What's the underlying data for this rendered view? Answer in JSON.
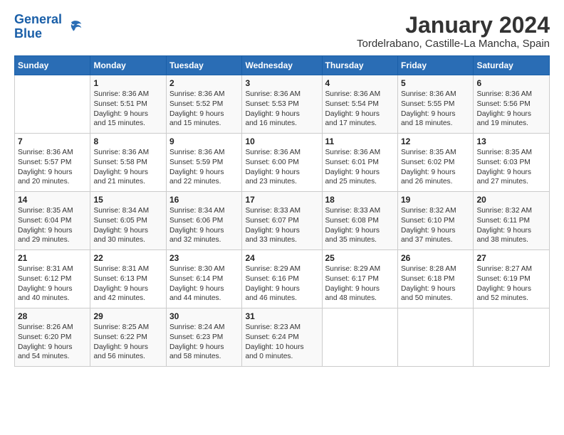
{
  "logo": {
    "text1": "General",
    "text2": "Blue"
  },
  "title": "January 2024",
  "subtitle": "Tordelrabano, Castille-La Mancha, Spain",
  "headers": [
    "Sunday",
    "Monday",
    "Tuesday",
    "Wednesday",
    "Thursday",
    "Friday",
    "Saturday"
  ],
  "weeks": [
    [
      {
        "num": "",
        "info": ""
      },
      {
        "num": "1",
        "info": "Sunrise: 8:36 AM\nSunset: 5:51 PM\nDaylight: 9 hours\nand 15 minutes."
      },
      {
        "num": "2",
        "info": "Sunrise: 8:36 AM\nSunset: 5:52 PM\nDaylight: 9 hours\nand 15 minutes."
      },
      {
        "num": "3",
        "info": "Sunrise: 8:36 AM\nSunset: 5:53 PM\nDaylight: 9 hours\nand 16 minutes."
      },
      {
        "num": "4",
        "info": "Sunrise: 8:36 AM\nSunset: 5:54 PM\nDaylight: 9 hours\nand 17 minutes."
      },
      {
        "num": "5",
        "info": "Sunrise: 8:36 AM\nSunset: 5:55 PM\nDaylight: 9 hours\nand 18 minutes."
      },
      {
        "num": "6",
        "info": "Sunrise: 8:36 AM\nSunset: 5:56 PM\nDaylight: 9 hours\nand 19 minutes."
      }
    ],
    [
      {
        "num": "7",
        "info": "Sunrise: 8:36 AM\nSunset: 5:57 PM\nDaylight: 9 hours\nand 20 minutes."
      },
      {
        "num": "8",
        "info": "Sunrise: 8:36 AM\nSunset: 5:58 PM\nDaylight: 9 hours\nand 21 minutes."
      },
      {
        "num": "9",
        "info": "Sunrise: 8:36 AM\nSunset: 5:59 PM\nDaylight: 9 hours\nand 22 minutes."
      },
      {
        "num": "10",
        "info": "Sunrise: 8:36 AM\nSunset: 6:00 PM\nDaylight: 9 hours\nand 23 minutes."
      },
      {
        "num": "11",
        "info": "Sunrise: 8:36 AM\nSunset: 6:01 PM\nDaylight: 9 hours\nand 25 minutes."
      },
      {
        "num": "12",
        "info": "Sunrise: 8:35 AM\nSunset: 6:02 PM\nDaylight: 9 hours\nand 26 minutes."
      },
      {
        "num": "13",
        "info": "Sunrise: 8:35 AM\nSunset: 6:03 PM\nDaylight: 9 hours\nand 27 minutes."
      }
    ],
    [
      {
        "num": "14",
        "info": "Sunrise: 8:35 AM\nSunset: 6:04 PM\nDaylight: 9 hours\nand 29 minutes."
      },
      {
        "num": "15",
        "info": "Sunrise: 8:34 AM\nSunset: 6:05 PM\nDaylight: 9 hours\nand 30 minutes."
      },
      {
        "num": "16",
        "info": "Sunrise: 8:34 AM\nSunset: 6:06 PM\nDaylight: 9 hours\nand 32 minutes."
      },
      {
        "num": "17",
        "info": "Sunrise: 8:33 AM\nSunset: 6:07 PM\nDaylight: 9 hours\nand 33 minutes."
      },
      {
        "num": "18",
        "info": "Sunrise: 8:33 AM\nSunset: 6:08 PM\nDaylight: 9 hours\nand 35 minutes."
      },
      {
        "num": "19",
        "info": "Sunrise: 8:32 AM\nSunset: 6:10 PM\nDaylight: 9 hours\nand 37 minutes."
      },
      {
        "num": "20",
        "info": "Sunrise: 8:32 AM\nSunset: 6:11 PM\nDaylight: 9 hours\nand 38 minutes."
      }
    ],
    [
      {
        "num": "21",
        "info": "Sunrise: 8:31 AM\nSunset: 6:12 PM\nDaylight: 9 hours\nand 40 minutes."
      },
      {
        "num": "22",
        "info": "Sunrise: 8:31 AM\nSunset: 6:13 PM\nDaylight: 9 hours\nand 42 minutes."
      },
      {
        "num": "23",
        "info": "Sunrise: 8:30 AM\nSunset: 6:14 PM\nDaylight: 9 hours\nand 44 minutes."
      },
      {
        "num": "24",
        "info": "Sunrise: 8:29 AM\nSunset: 6:16 PM\nDaylight: 9 hours\nand 46 minutes."
      },
      {
        "num": "25",
        "info": "Sunrise: 8:29 AM\nSunset: 6:17 PM\nDaylight: 9 hours\nand 48 minutes."
      },
      {
        "num": "26",
        "info": "Sunrise: 8:28 AM\nSunset: 6:18 PM\nDaylight: 9 hours\nand 50 minutes."
      },
      {
        "num": "27",
        "info": "Sunrise: 8:27 AM\nSunset: 6:19 PM\nDaylight: 9 hours\nand 52 minutes."
      }
    ],
    [
      {
        "num": "28",
        "info": "Sunrise: 8:26 AM\nSunset: 6:20 PM\nDaylight: 9 hours\nand 54 minutes."
      },
      {
        "num": "29",
        "info": "Sunrise: 8:25 AM\nSunset: 6:22 PM\nDaylight: 9 hours\nand 56 minutes."
      },
      {
        "num": "30",
        "info": "Sunrise: 8:24 AM\nSunset: 6:23 PM\nDaylight: 9 hours\nand 58 minutes."
      },
      {
        "num": "31",
        "info": "Sunrise: 8:23 AM\nSunset: 6:24 PM\nDaylight: 10 hours\nand 0 minutes."
      },
      {
        "num": "",
        "info": ""
      },
      {
        "num": "",
        "info": ""
      },
      {
        "num": "",
        "info": ""
      }
    ]
  ]
}
